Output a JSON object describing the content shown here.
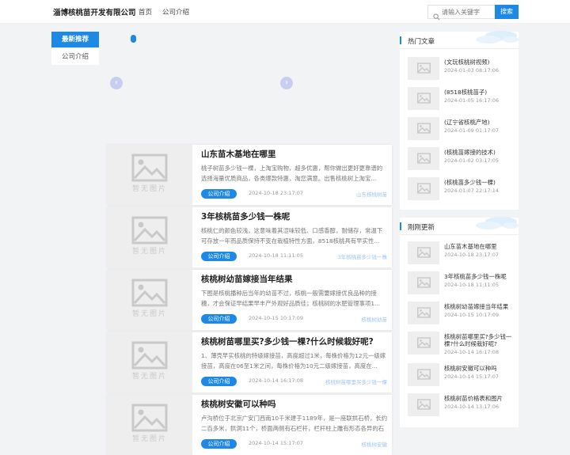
{
  "header": {
    "logo": "淄博核桃苗开发有限公司",
    "nav": [
      "首页",
      "公司介绍"
    ],
    "search_placeholder": "请输入关键字",
    "search_button": "搜索"
  },
  "tabs": {
    "active": "最新推荐",
    "normal": "公司介绍"
  },
  "no_image_text": "暂无图片",
  "articles": [
    {
      "title": "山东苗木基地在哪里",
      "desc": "桃子树苗多少钱一棵，上淘宝购物，超多优惠，帮你做出更好更靠谱的选择海量优质商品，各类爆款特惠，淘您满意。出售核桃树上淘宝...",
      "category": "公司介绍",
      "date": "2024-10-18 23:17:07",
      "tag": "山东核桃树苗"
    },
    {
      "title": "3年核桃苗多少钱一株呢",
      "desc": "核桃仁的颜色较浅，这意味着其涩味较低、口感香醇，耐储存，常温下可存放一年而品质保持不变在栽植特性方面，8518核桃具有早实性...",
      "category": "公司介绍",
      "date": "2024-10-18 11:11:05",
      "tag": "3年核桃苗多少钱一株"
    },
    {
      "title": "核桃树幼苗嫁接当年结果",
      "desc": "下图是核桃播种后当年的幼苗不过，核桃一般需要嫁接优良品种的接穗，才会保证早结果早丰产外观好品质佳；核桃树的水肥管理事项1...",
      "category": "公司介绍",
      "date": "2024-10-15 10:17:09",
      "tag": "核桃树幼苗"
    },
    {
      "title": "核桃树苗哪里买?多少钱一棵?什么时候栽好呢?",
      "desc": "1、薄壳早实核桃的特级嫁接苗，高度超过1米，每株价格为12元一级嫁接苗，高度在06至1米之间，每株价格为10元二级嫁接苗，高度在...",
      "category": "公司介绍",
      "date": "2024-10-14 16:17:08",
      "tag": "核桃树苗哪里买多少钱一棵"
    },
    {
      "title": "核桃树安徽可以种吗",
      "desc": "卢沟桥位于北京广安门西南10千米建于1189年，是一座联拱石桥，长约二百多米，拱洞11个，桥面两侧有石栏杆，栏杆柱上雕有形态各异的石狮子...",
      "category": "公司介绍",
      "date": "2024-10-14 15:17:07",
      "tag": "核桃树安徽"
    }
  ],
  "hot": {
    "title": "热门文章",
    "items": [
      {
        "title": "(文玩核桃树视频)",
        "date": "2024-01-03 08:17:06"
      },
      {
        "title": "(8518核桃苗子)",
        "date": "2024-01-05 16:17:06"
      },
      {
        "title": "(辽宁省核桃产地)",
        "date": "2024-01-09 01:17:07"
      },
      {
        "title": "(核桃苗嫁接的技术)",
        "date": "2024-01-02 03:17:05"
      },
      {
        "title": "(核桃苗多少钱一棵)",
        "date": "2024-01-07 22:17:14"
      }
    ]
  },
  "recent": {
    "title": "刚刚更新",
    "items": [
      {
        "title": "山东苗木基地在哪里",
        "date": "2024-10-18 23:17:07"
      },
      {
        "title": "3年核桃苗多少钱一株呢",
        "date": "2024-10-18 11:11:05"
      },
      {
        "title": "核桃树幼苗嫁接当年结果",
        "date": "2024-10-15 10:17:09"
      },
      {
        "title": "核桃树苗哪里买?多少钱一棵?什么时候栽好呢?",
        "date": "2024-10-14 16:17:08"
      },
      {
        "title": "核桃树安徽可以种吗",
        "date": "2024-10-14 15:17:07"
      },
      {
        "title": "核桃树苗价格表和图片",
        "date": "2024-10-14 13:17:06"
      }
    ]
  },
  "colors": {
    "accent": "#1e88e5",
    "page_bg": "#f2f3f5"
  }
}
